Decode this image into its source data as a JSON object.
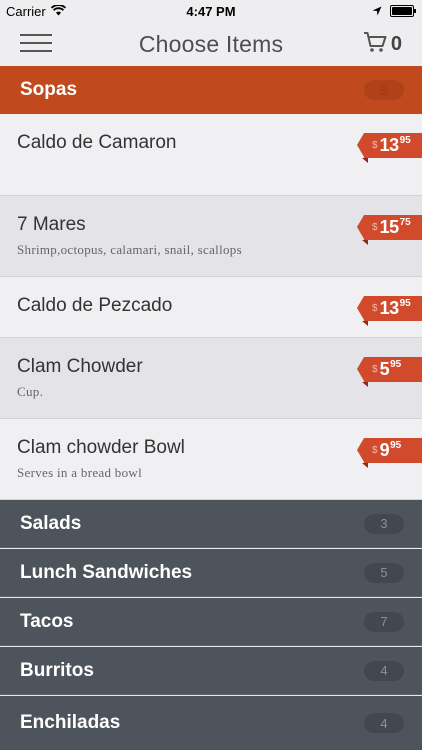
{
  "status_bar": {
    "carrier": "Carrier",
    "time": "4:47 PM"
  },
  "nav": {
    "title": "Choose Items",
    "cart_count": "0"
  },
  "active_category": {
    "name": "Sopas",
    "count": "5"
  },
  "items": [
    {
      "name": "Caldo de Camaron",
      "description": "",
      "currency": "$",
      "price_whole": "13",
      "price_cents": "95"
    },
    {
      "name": "7 Mares",
      "description": "Shrimp,octopus, calamari, snail, scallops",
      "currency": "$",
      "price_whole": "15",
      "price_cents": "75"
    },
    {
      "name": "Caldo de Pezcado",
      "description": "",
      "currency": "$",
      "price_whole": "13",
      "price_cents": "95"
    },
    {
      "name": "Clam Chowder",
      "description": "Cup.",
      "currency": "$",
      "price_whole": "5",
      "price_cents": "95"
    },
    {
      "name": "Clam chowder  Bowl",
      "description": "Serves in a bread bowl",
      "currency": "$",
      "price_whole": "9",
      "price_cents": "95"
    }
  ],
  "categories": [
    {
      "name": "Salads",
      "count": "3"
    },
    {
      "name": "Lunch Sandwiches",
      "count": "5"
    },
    {
      "name": "Tacos",
      "count": "7"
    },
    {
      "name": "Burritos",
      "count": "4"
    },
    {
      "name": "Enchiladas",
      "count": "4"
    }
  ],
  "colors": {
    "accent": "#c04a1d",
    "price_tag": "#d24a2c",
    "dark_category": "#4e545c"
  },
  "icons": [
    "wifi-icon",
    "location-arrow-icon",
    "battery-icon",
    "hamburger-menu-icon",
    "cart-icon"
  ]
}
